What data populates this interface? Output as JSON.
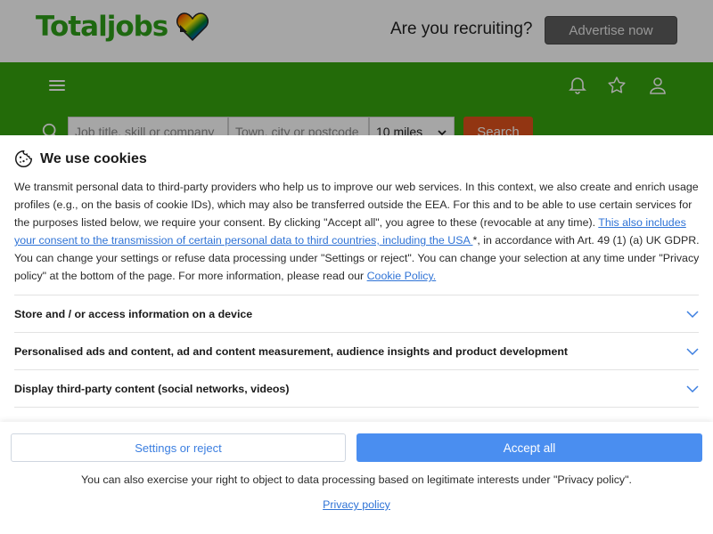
{
  "site": {
    "logo_text": "Totaljobs",
    "recruit_text": "Are you recruiting?",
    "advertise_label": "Advertise now",
    "colors": {
      "brand_green": "#37a50f",
      "logo_green": "#2ea01a",
      "search_orange": "#e0521c"
    }
  },
  "search": {
    "job_placeholder": "Job title, skill or company",
    "town_placeholder": "Town, city or postcode",
    "radius_value": "10 miles",
    "button_label": "Search"
  },
  "cookie": {
    "title": "We use cookies",
    "body_part1": "We transmit personal data to third-party providers who help us to improve our web services. In this context, we also create and enrich usage profiles (e.g., on the basis of cookie IDs), which may also be transferred outside the EEA. For this and to be able to use certain services for the purposes listed below, we require your consent. By clicking \"Accept all\", you agree to these (revocable at any time). ",
    "consent_link": "This also includes your consent to the transmission of certain personal data to third countries, including the USA ",
    "body_part2": "*, in accordance with Art. 49 (1) (a) UK GDPR. You can change your settings or refuse data processing under \"Settings or reject\". You can change your selection at any time under \"Privacy policy\" at the bottom of the page. For more information, please read our ",
    "policy_link": "Cookie Policy.",
    "purposes": [
      {
        "label": "Store and / or access information on a device"
      },
      {
        "label": "Personalised ads and content, ad and content measurement, audience insights and product development"
      },
      {
        "label": "Display third-party content (social networks, videos)"
      }
    ],
    "settings_label": "Settings or reject",
    "accept_label": "Accept all",
    "footer_note": "You can also exercise your right to object to data processing based on legitimate interests under \"Privacy policy\".",
    "privacy_label": "Privacy policy",
    "colors": {
      "link": "#2f73d6",
      "accept_bg": "#4a8ef0"
    }
  },
  "icons": [
    "heart-logo-icon",
    "menu-icon",
    "bell-icon",
    "star-icon",
    "user-icon",
    "search-icon",
    "chevron-down-icon",
    "cookie-icon"
  ]
}
